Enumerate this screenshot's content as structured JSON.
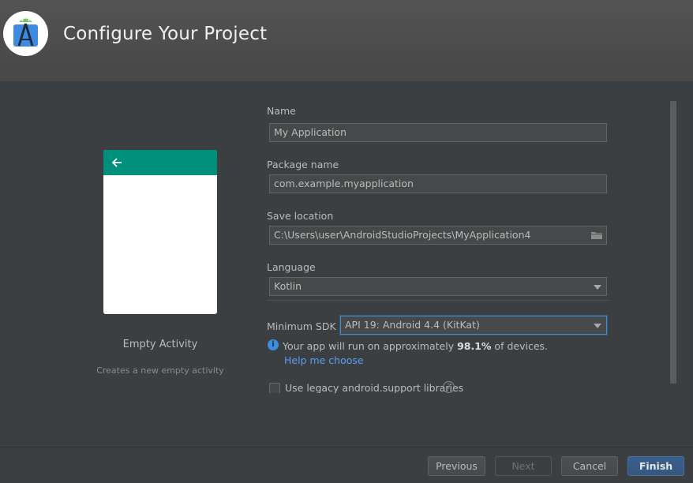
{
  "header": {
    "title": "Configure Your Project",
    "logo_icon": "android-studio-icon"
  },
  "template": {
    "name": "Empty Activity",
    "description": "Creates a new empty activity",
    "appbar_color": "#008f7a"
  },
  "form": {
    "name_label": "Name",
    "name_value": "My Application",
    "package_label": "Package name",
    "package_value": "com.example.myapplication",
    "location_label": "Save location",
    "location_value": "C:\\Users\\user\\AndroidStudioProjects\\MyApplication4",
    "language_label": "Language",
    "language_value": "Kotlin",
    "min_sdk_label": "Minimum SDK",
    "min_sdk_value": "API 19: Android 4.4 (KitKat)",
    "info_prefix": "Your app will run on approximately ",
    "info_percent": "98.1%",
    "info_suffix": " of devices.",
    "help_link": "Help me choose",
    "legacy_label": "Use legacy android.support libraries"
  },
  "footer": {
    "previous": "Previous",
    "next": "Next",
    "cancel": "Cancel",
    "finish": "Finish"
  },
  "colors": {
    "background": "#3c3f41",
    "accent_link": "#589df6",
    "primary_button": "#365880"
  }
}
